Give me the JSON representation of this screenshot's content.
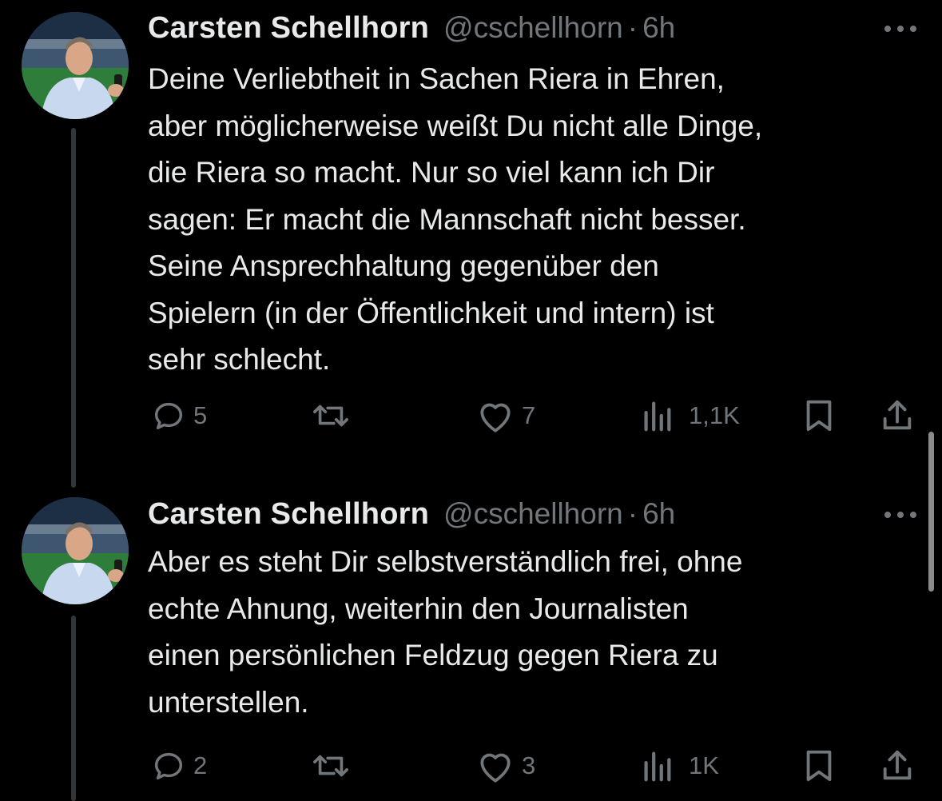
{
  "tweets": [
    {
      "author_name": "Carsten Schellhorn",
      "handle": "@cschellhorn",
      "separator": "·",
      "time": "6h",
      "text": "Deine Verliebtheit in Sachen Riera in Ehren,\naber möglicherweise weißt Du nicht alle Dinge,\ndie Riera so macht. Nur so viel kann ich Dir\nsagen: Er macht die Mannschaft nicht besser.\nSeine Ansprechhaltung gegenüber den\nSpielern (in der Öffentlichkeit und intern) ist\nsehr schlecht.",
      "replies": "5",
      "retweets": "",
      "likes": "7",
      "views": "1,1K"
    },
    {
      "author_name": "Carsten Schellhorn",
      "handle": "@cschellhorn",
      "separator": "·",
      "time": "6h",
      "text": "Aber es steht Dir selbstverständlich frei, ohne\nechte Ahnung, weiterhin den Journalisten\neinen persönlichen Feldzug gegen Riera zu\nunterstellen.",
      "replies": "2",
      "retweets": "",
      "likes": "3",
      "views": "1K"
    }
  ],
  "icons": {
    "reply": "speech-bubble-icon",
    "retweet": "retweet-arrows-icon",
    "like": "heart-outline-icon",
    "views": "bar-chart-icon",
    "bookmark": "bookmark-icon",
    "share": "share-upload-icon",
    "more": "horizontal-ellipsis-icon"
  },
  "colors": {
    "background": "#000000",
    "primary_text": "#e7e9ea",
    "secondary_text": "#71767b",
    "thread_line": "#333639"
  }
}
